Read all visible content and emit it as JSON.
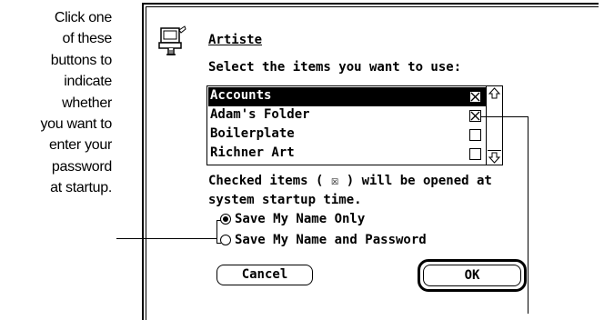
{
  "callout": {
    "lines": [
      "Click one",
      "of these",
      "buttons to",
      "indicate",
      "whether",
      "you want to",
      "enter your",
      "password",
      "at startup."
    ]
  },
  "dialog": {
    "title": "Artiste",
    "prompt": "Select the items you want to use:",
    "items": [
      {
        "label": "Accounts",
        "checked": true,
        "selected": true
      },
      {
        "label": "Adam's Folder",
        "checked": true,
        "selected": false
      },
      {
        "label": "Boilerplate",
        "checked": false,
        "selected": false
      },
      {
        "label": "Richner Art",
        "checked": false,
        "selected": false
      }
    ],
    "note_line1": "Checked items ( ☒ ) will be opened at",
    "note_line2": "system startup time.",
    "radio_name_only": "Save My Name Only",
    "radio_name_password": "Save My Name and Password",
    "selected_radio": "name_only",
    "cancel_label": "Cancel",
    "ok_label": "OK"
  },
  "icons": {
    "app_icon": "computer-with-hand-icon",
    "scroll_up": "scroll-up-arrow-icon",
    "scroll_down": "scroll-down-arrow-icon",
    "checkbox_checked": "checkbox-x-icon"
  }
}
